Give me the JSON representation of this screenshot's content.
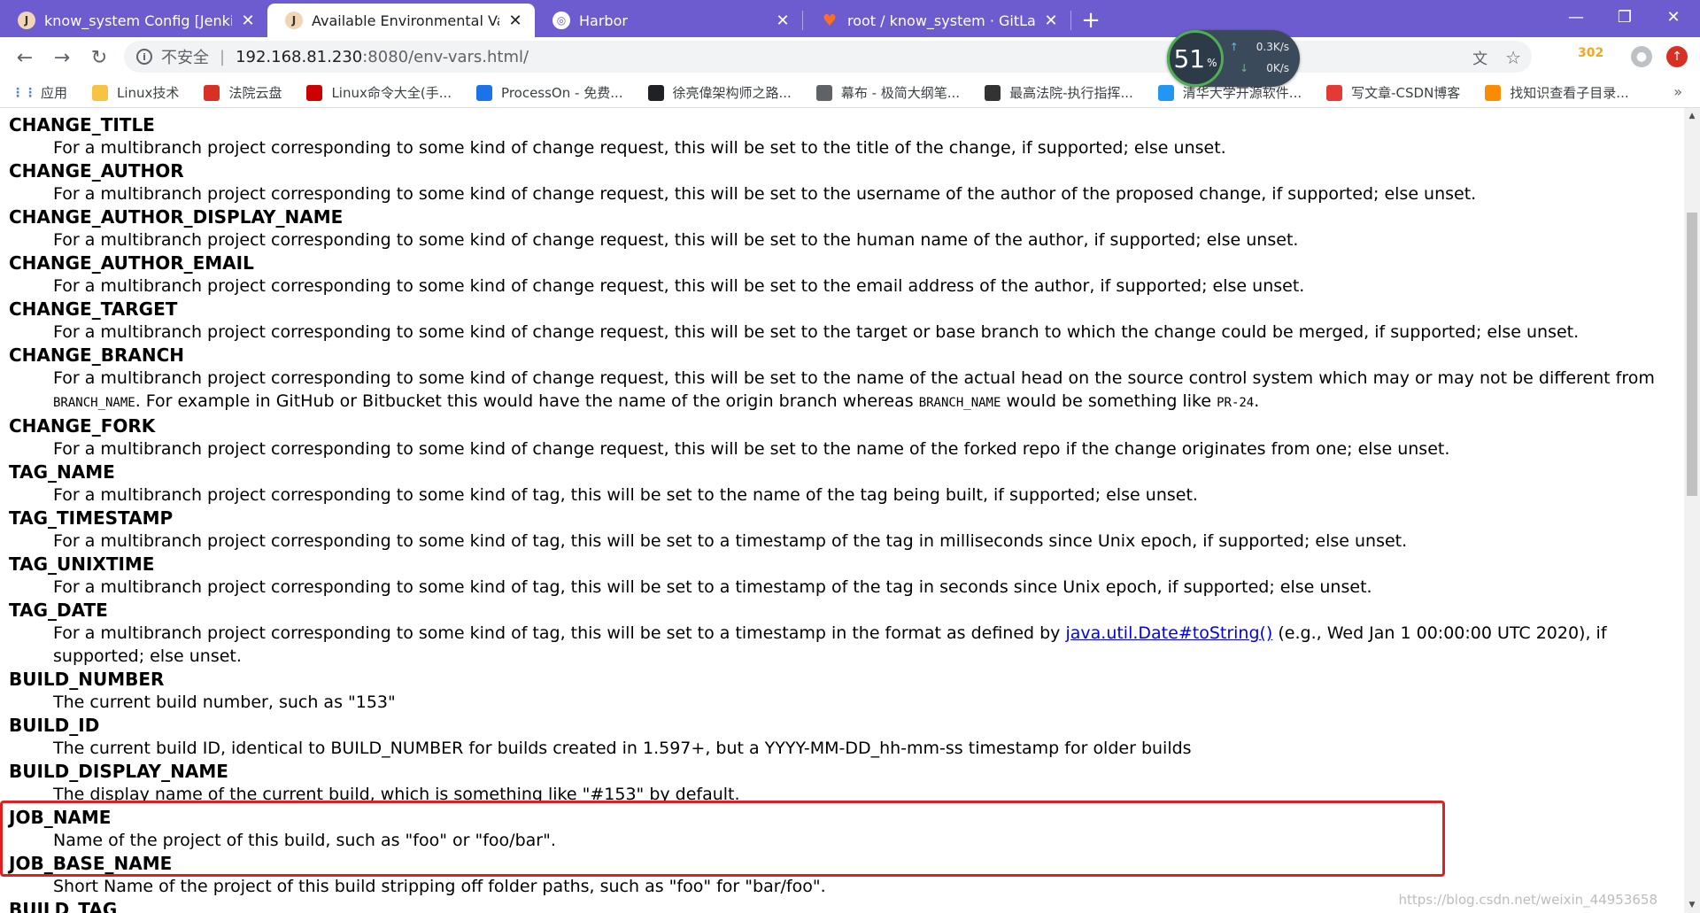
{
  "browser": {
    "tabs": [
      {
        "title": "know_system Config [Jenkins]",
        "icon": "jenkins-icon",
        "active": false
      },
      {
        "title": "Available Environmental Varial",
        "icon": "jenkins-icon",
        "active": true
      },
      {
        "title": "Harbor",
        "icon": "harbor-icon",
        "active": false
      },
      {
        "title": "root / know_system · GitLab",
        "icon": "gitlab-icon",
        "active": false
      }
    ],
    "new_tab": "+",
    "address": {
      "security_label": "不安全",
      "separator": "|",
      "host": "192.168.81.230",
      "path": ":8080/env-vars.html/"
    },
    "network_widget": {
      "cpu_percent": "51",
      "percent_sign": "%",
      "upload_rate": "0.3K/s",
      "download_rate": "0K/s"
    },
    "extension_badge": "302",
    "bookmarks": [
      {
        "label": "应用",
        "icon": "apps-grid-icon",
        "color": "#4285f4"
      },
      {
        "label": "Linux技术",
        "icon": "folder-icon",
        "color": "#f6c343"
      },
      {
        "label": "法院云盘",
        "icon": "cloud-drive-icon",
        "color": "#d93025"
      },
      {
        "label": "Linux命令大全(手...",
        "icon": "redhat-icon",
        "color": "#cc0000"
      },
      {
        "label": "ProcessOn - 免费...",
        "icon": "processon-icon",
        "color": "#1a73e8"
      },
      {
        "label": "徐亮偉架构师之路...",
        "icon": "blog-icon",
        "color": "#202124"
      },
      {
        "label": "幕布 - 极简大纲笔...",
        "icon": "mubu-icon",
        "color": "#5f6368"
      },
      {
        "label": "最高法院-执行指挥...",
        "icon": "court-icon",
        "color": "#333333"
      },
      {
        "label": "清华大学开源软件...",
        "icon": "tsinghua-icon",
        "color": "#2196f3"
      },
      {
        "label": "写文章-CSDN博客",
        "icon": "csdn-icon",
        "color": "#e53935"
      },
      {
        "label": "找知识查看子目录...",
        "icon": "knowledge-icon",
        "color": "#fb8c00"
      }
    ],
    "bookmarks_more": "»"
  },
  "content": {
    "entries": [
      {
        "name": "CHANGE_TITLE",
        "desc": "For a multibranch project corresponding to some kind of change request, this will be set to the title of the change, if supported; else unset."
      },
      {
        "name": "CHANGE_AUTHOR",
        "desc": "For a multibranch project corresponding to some kind of change request, this will be set to the username of the author of the proposed change, if supported; else unset."
      },
      {
        "name": "CHANGE_AUTHOR_DISPLAY_NAME",
        "desc": "For a multibranch project corresponding to some kind of change request, this will be set to the human name of the author, if supported; else unset."
      },
      {
        "name": "CHANGE_AUTHOR_EMAIL",
        "desc": "For a multibranch project corresponding to some kind of change request, this will be set to the email address of the author, if supported; else unset."
      },
      {
        "name": "CHANGE_TARGET",
        "desc": "For a multibranch project corresponding to some kind of change request, this will be set to the target or base branch to which the change could be merged, if supported; else unset."
      },
      {
        "name": "CHANGE_BRANCH",
        "desc_parts": [
          "For a multibranch project corresponding to some kind of change request, this will be set to the name of the actual head on the source control system which may or may not be different from ",
          "BRANCH_NAME",
          ". For example in GitHub or Bitbucket this would have the name of the origin branch whereas ",
          "BRANCH_NAME",
          " would be something like ",
          "PR-24",
          "."
        ]
      },
      {
        "name": "CHANGE_FORK",
        "desc": "For a multibranch project corresponding to some kind of change request, this will be set to the name of the forked repo if the change originates from one; else unset."
      },
      {
        "name": "TAG_NAME",
        "desc": "For a multibranch project corresponding to some kind of tag, this will be set to the name of the tag being built, if supported; else unset."
      },
      {
        "name": "TAG_TIMESTAMP",
        "desc": "For a multibranch project corresponding to some kind of tag, this will be set to a timestamp of the tag in milliseconds since Unix epoch, if supported; else unset."
      },
      {
        "name": "TAG_UNIXTIME",
        "desc": "For a multibranch project corresponding to some kind of tag, this will be set to a timestamp of the tag in seconds since Unix epoch, if supported; else unset."
      },
      {
        "name": "TAG_DATE",
        "desc_parts": [
          "For a multibranch project corresponding to some kind of tag, this will be set to a timestamp in the format as defined by ",
          "java.util.Date#toString()",
          " (e.g., Wed Jan 1 00:00:00 UTC 2020), if supported; else unset."
        ]
      },
      {
        "name": "BUILD_NUMBER",
        "desc": "The current build number, such as \"153\""
      },
      {
        "name": "BUILD_ID",
        "desc": "The current build ID, identical to BUILD_NUMBER for builds created in 1.597+, but a YYYY-MM-DD_hh-mm-ss timestamp for older builds"
      },
      {
        "name": "BUILD_DISPLAY_NAME",
        "desc": "The display name of the current build, which is something like \"#153\" by default."
      },
      {
        "name": "JOB_NAME",
        "desc": "Name of the project of this build, such as \"foo\" or \"foo/bar\"."
      },
      {
        "name": "JOB_BASE_NAME",
        "desc": "Short Name of the project of this build stripping off folder paths, such as \"foo\" for \"bar/foo\"."
      },
      {
        "name": "BUILD_TAG",
        "desc": ""
      }
    ],
    "watermark": "https://blog.csdn.net/weixin_44953658"
  },
  "colors": {
    "tabstrip": "#6d5bd0",
    "link": "#0000ee",
    "highlight": "#e02020"
  }
}
